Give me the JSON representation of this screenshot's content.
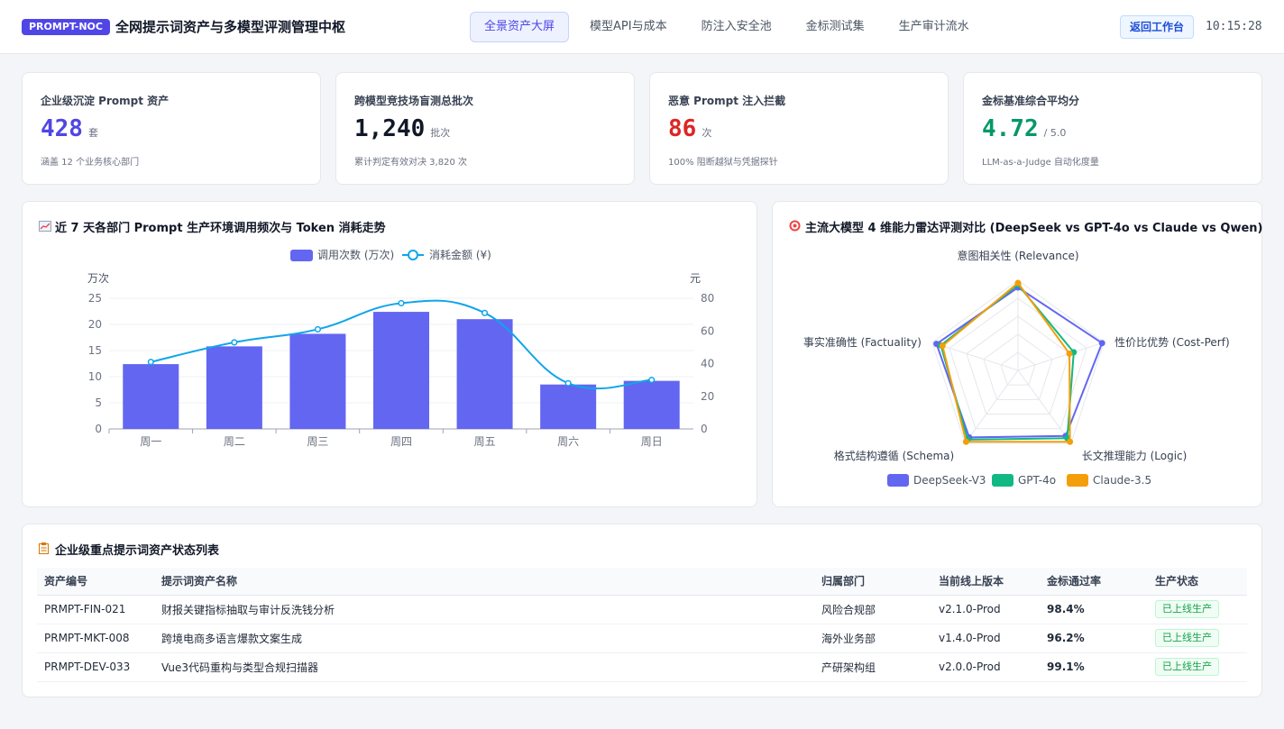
{
  "header": {
    "badge": "PROMPT-NOC",
    "title": "全网提示词资产与多模型评测管理中枢",
    "tabs": [
      {
        "label": "全景资产大屏",
        "active": true
      },
      {
        "label": "模型API与成本",
        "active": false
      },
      {
        "label": "防注入安全池",
        "active": false
      },
      {
        "label": "金标测试集",
        "active": false
      },
      {
        "label": "生产审计流水",
        "active": false
      }
    ],
    "back_label": "返回工作台",
    "time": "10:15:28"
  },
  "kpis": [
    {
      "label": "企业级沉淀 Prompt 资产",
      "value": "428",
      "unit": "套",
      "note": "涵盖 12 个业务核心部门",
      "color": "#4f46e5"
    },
    {
      "label": "跨模型竞技场盲测总批次",
      "value": "1,240",
      "unit": "批次",
      "note": "累计判定有效对决 3,820 次",
      "color": "#111827"
    },
    {
      "label": "恶意 Prompt 注入拦截",
      "value": "86",
      "unit": "次",
      "note": "100% 阻断越狱与凭据探针",
      "color": "#dc2626"
    },
    {
      "label": "金标基准综合平均分",
      "value": "4.72",
      "unit": "/ 5.0",
      "note": "LLM-as-a-Judge 自动化度量",
      "color": "#059669"
    }
  ],
  "trend_card": {
    "icon": "chart-increasing-icon",
    "title": "近 7 天各部门 Prompt 生产环境调用频次与 Token 消耗走势"
  },
  "radar_card": {
    "icon": "target-icon",
    "title": "主流大模型 4 维能力雷达评测对比 (DeepSeek vs GPT-4o vs Claude vs Qwen)"
  },
  "chart_data": [
    {
      "type": "bar",
      "categories": [
        "周一",
        "周二",
        "周三",
        "周四",
        "周五",
        "周六",
        "周日"
      ],
      "series": [
        {
          "name": "调用次数 (万次)",
          "kind": "bar",
          "axis": "left",
          "color": "#6366f1",
          "values": [
            12.4,
            15.8,
            18.2,
            22.4,
            21.0,
            8.5,
            9.2
          ]
        },
        {
          "name": "消耗金额 (¥)",
          "kind": "line",
          "axis": "right",
          "color": "#0ea5e9",
          "values": [
            41,
            53,
            61,
            77,
            71,
            28,
            30
          ]
        }
      ],
      "left_axis": {
        "unit": "万次",
        "ticks": [
          0,
          5,
          10,
          15,
          20,
          25
        ],
        "ylim": [
          0,
          25
        ]
      },
      "right_axis": {
        "unit": "元",
        "ticks": [
          0,
          20,
          40,
          60,
          80
        ],
        "ylim": [
          0,
          80
        ]
      },
      "legend": "top-center",
      "grid": true
    },
    {
      "type": "radar",
      "indicators": [
        "意图相关性 (Relevance)",
        "性价比优势 (Cost-Perf)",
        "长文推理能力 (Logic)",
        "格式结构遵循 (Schema)",
        "事实准确性 (Factuality)"
      ],
      "max": 10,
      "series": [
        {
          "name": "DeepSeek-V3",
          "color": "#6366f1",
          "values": [
            9.2,
            9.8,
            9.0,
            9.2,
            9.5
          ]
        },
        {
          "name": "GPT-4o",
          "color": "#10b981",
          "values": [
            9.5,
            6.5,
            9.3,
            9.5,
            9.0
          ]
        },
        {
          "name": "Claude-3.5",
          "color": "#f59e0b",
          "values": [
            9.7,
            6.0,
            9.8,
            9.8,
            8.8
          ]
        }
      ],
      "legend": "bottom-center"
    }
  ],
  "assets_table": {
    "icon": "clipboard-icon",
    "title": "企业级重点提示词资产状态列表",
    "columns": [
      "资产编号",
      "提示词资产名称",
      "归属部门",
      "当前线上版本",
      "金标通过率",
      "生产状态"
    ],
    "rows": [
      [
        "PRMPT-FIN-021",
        "财报关键指标抽取与审计反洗钱分析",
        "风险合规部",
        "v2.1.0-Prod",
        "98.4%",
        "已上线生产"
      ],
      [
        "PRMPT-MKT-008",
        "跨境电商多语言爆款文案生成",
        "海外业务部",
        "v1.4.0-Prod",
        "96.2%",
        "已上线生产"
      ],
      [
        "PRMPT-DEV-033",
        "Vue3代码重构与类型合规扫描器",
        "产研架构组",
        "v2.0.0-Prod",
        "99.1%",
        "已上线生产"
      ]
    ]
  }
}
